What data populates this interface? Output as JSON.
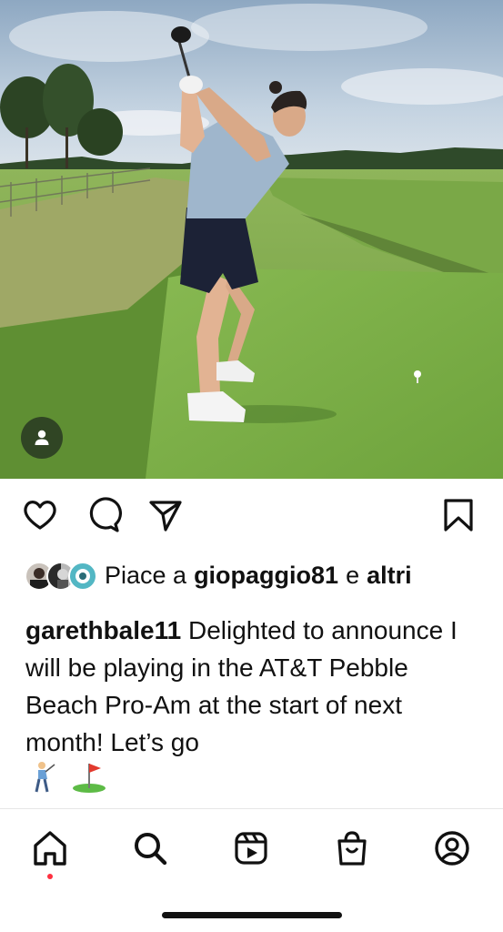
{
  "post": {
    "image_icon": "golf-photo",
    "tagged_people_icon": "person-icon"
  },
  "actions": {
    "like_icon": "heart-icon",
    "comment_icon": "comment-icon",
    "share_icon": "paper-plane-icon",
    "save_icon": "bookmark-icon"
  },
  "likes": {
    "prefix": "Piace a",
    "user": "giopaggio81",
    "joiner": "e",
    "others": "altri"
  },
  "caption": {
    "username": "garethbale11",
    "text": "Delighted to announce I will be playing in the AT&T Pebble Beach Pro-Am at the start of next month! Let’s go",
    "emojis": [
      "🏌️",
      "⛳"
    ]
  },
  "nav": {
    "items": [
      "home-icon",
      "search-icon",
      "reels-icon",
      "shop-icon",
      "profile-icon"
    ],
    "active": "home-icon",
    "notification_color": "#ff3040"
  }
}
